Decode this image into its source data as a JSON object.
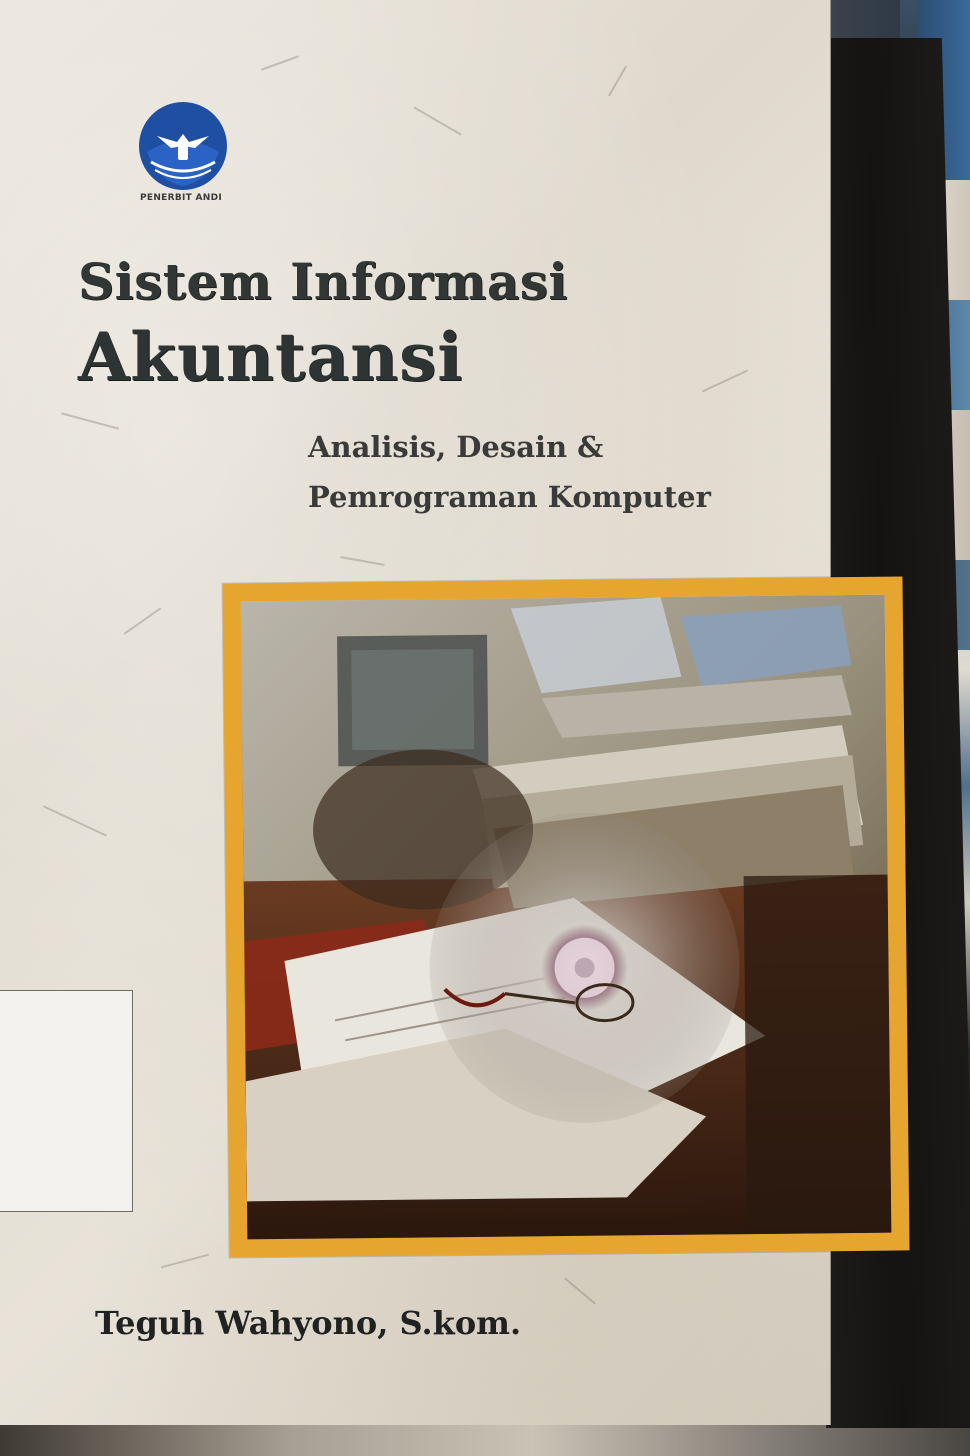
{
  "publisher": {
    "name": "PENERBIT ANDI",
    "logo_icon": "winged-crest-icon",
    "logo_color": "#1f4fa3"
  },
  "book": {
    "title_line_1": "Sistem Informasi",
    "title_line_2": "Akuntansi",
    "subtitle_line_1": "Analisis, Desain &",
    "subtitle_line_2": "Pemrograman Komputer",
    "author": "Teguh Wahyono, S.kom."
  },
  "colors": {
    "frame": "#e6a52e",
    "spine": "#161514",
    "cover": "#e5e0d5",
    "title_text": "#2e3433"
  }
}
